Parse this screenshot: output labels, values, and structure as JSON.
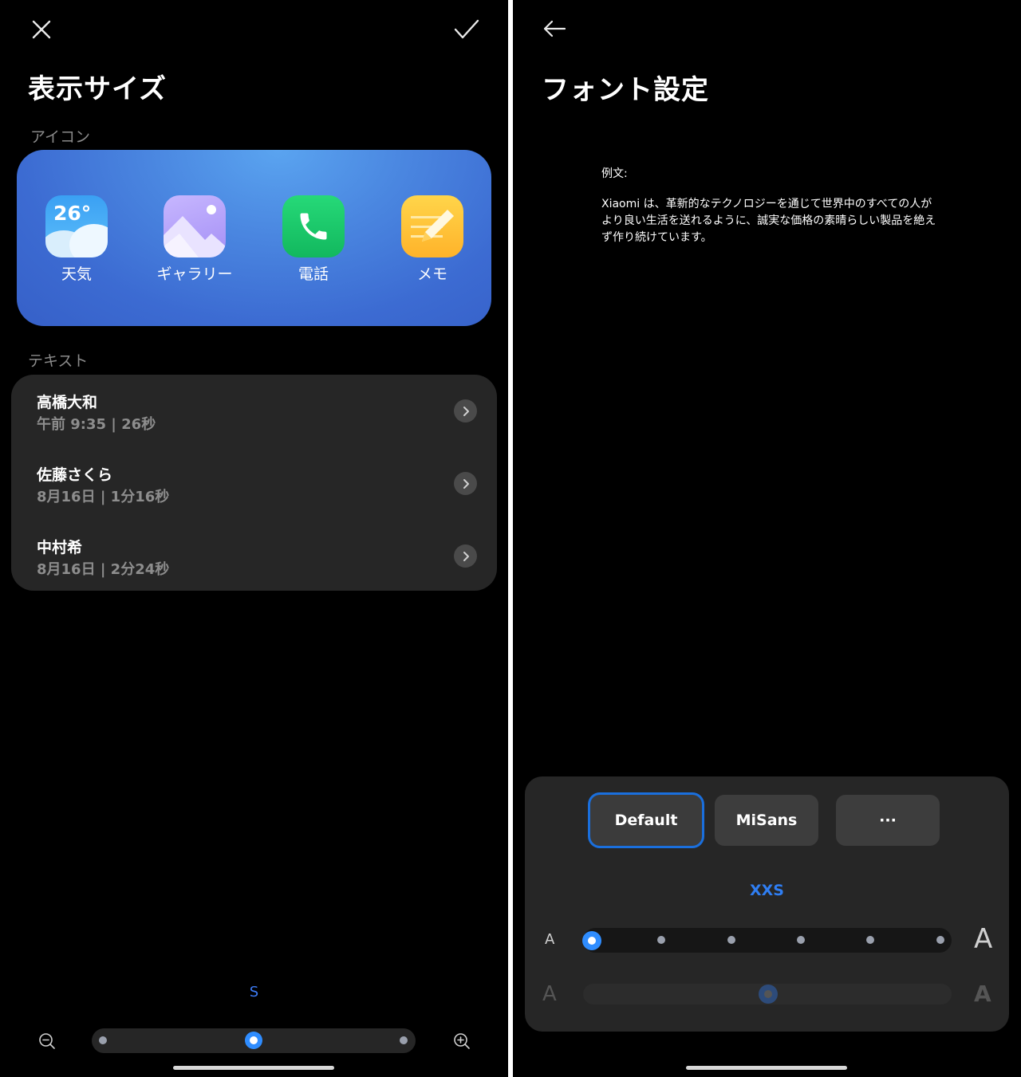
{
  "left": {
    "title": "表示サイズ",
    "icons_section": "アイコン",
    "apps": [
      {
        "label": "天気",
        "icon": "weather-icon",
        "temp": "26°"
      },
      {
        "label": "ギャラリー",
        "icon": "gallery-icon"
      },
      {
        "label": "電話",
        "icon": "phone-icon"
      },
      {
        "label": "メモ",
        "icon": "memo-icon"
      }
    ],
    "text_section": "テキスト",
    "calls": [
      {
        "name": "高橋大和",
        "meta": "午前 9:35 | 26秒"
      },
      {
        "name": "佐藤さくら",
        "meta": "8月16日 | 1分16秒"
      },
      {
        "name": "中村希",
        "meta": "8月16日 | 2分24秒"
      }
    ],
    "size_label": "S",
    "slider": {
      "steps": 3,
      "selected_index": 1
    }
  },
  "right": {
    "title": "フォント設定",
    "sample_label": "例文:",
    "sample_text": "Xiaomi は、革新的なテクノロジーを通じて世界中のすべての人がより良い生活を送れるように、誠実な価格の素晴らしい製品を絶えず作り続けています。",
    "fonts": [
      {
        "label": "Default",
        "selected": true
      },
      {
        "label": "MiSans",
        "selected": false
      },
      {
        "label": "···",
        "selected": false
      }
    ],
    "size_name": "XXS",
    "size_slider": {
      "steps": 6,
      "selected_index": 0,
      "min_label": "A",
      "max_label": "A"
    },
    "weight_slider": {
      "value_fraction": 0.5,
      "min_label": "A",
      "max_label": "A"
    }
  },
  "colors": {
    "accent": "#2f8dff",
    "card": "#262626",
    "background": "#000000"
  }
}
